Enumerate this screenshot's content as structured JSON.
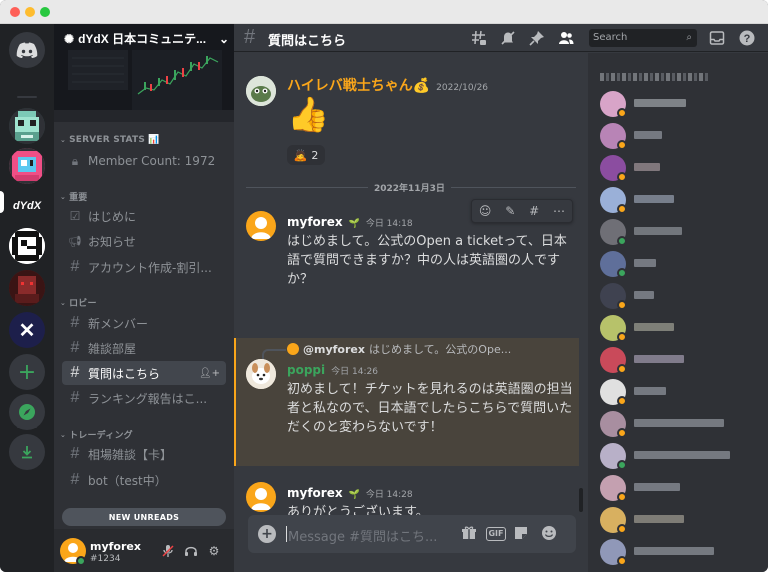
{
  "server": {
    "name": "dYdX 日本コミュニテ...",
    "icons": [
      "discord-home",
      "pixel-server-1",
      "pixel-server-2",
      "dydx",
      "pixel-server-3",
      "pixel-server-4",
      "x-server",
      "add-server",
      "explore",
      "download"
    ]
  },
  "rail": {
    "dydx_label": "dYdX"
  },
  "sidebar": {
    "stats_category": "SERVER STATS 📊",
    "member_count": "Member Count: 1972",
    "cat_important": "重要",
    "cat_lobby": "ロビー",
    "cat_trading": "トレーディング",
    "channels_important": [
      "はじめに",
      "お知らせ",
      "アカウント作成-割引..."
    ],
    "channels_lobby": [
      "新メンバー",
      "雑談部屋",
      "質問はこちら",
      "ランキング報告はこ..."
    ],
    "channels_trading": [
      "相場雑談【卡】",
      "bot（test中）"
    ],
    "new_unreads": "NEW UNREADS",
    "user": {
      "name": "myforex",
      "tag": "#1234"
    }
  },
  "header": {
    "title": "質問はこちら",
    "search_placeholder": "Search"
  },
  "messages": {
    "m1": {
      "author": "ハイレバ戦士ちゃん💰",
      "timestamp": "2022/10/26",
      "content": "👍",
      "reaction_emoji": "🙇",
      "reaction_count": "2"
    },
    "date_divider": "2022年11月3日",
    "m2": {
      "author": "myforex",
      "badge": "🌱",
      "timestamp": "今日 14:18",
      "content": "はじめまして。公式のOpen a ticketって、日本語で質問できますか？中の人は英語圏の人ですか？"
    },
    "m3": {
      "reply_author": "@myforex",
      "reply_preview": "はじめまして。公式のOpe...",
      "author": "poppi",
      "timestamp": "今日 14:26",
      "content": "初めまして！チケットを見れるのは英語圏の担当者と私なので、日本語でしたらこちらで質問いただくのと変わらないです！"
    },
    "m4": {
      "author": "myforex",
      "badge": "🌱",
      "timestamp": "今日 14:28",
      "content": "ありがとうございます。"
    }
  },
  "composer": {
    "placeholder": "Message #質問はこち...",
    "gif_label": "GIF"
  },
  "colors": {
    "accent": "#5865f2",
    "online": "#3ba55d",
    "highlight": "#faa61a",
    "poppi": "#3ba55d",
    "haireba": "#faa61a"
  }
}
